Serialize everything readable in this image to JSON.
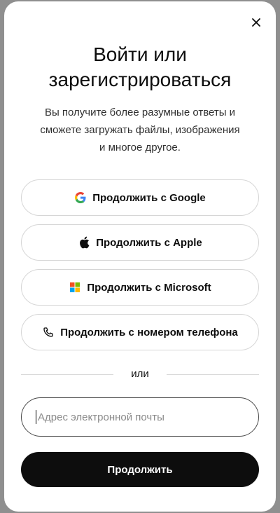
{
  "dialog": {
    "close_icon": "close-icon",
    "title_line1": "Войти или",
    "title_line2": "зарегистрироваться",
    "subtitle_line1": "Вы получите более разумные ответы и",
    "subtitle_line2": "сможете загружать файлы, изображения",
    "subtitle_line3": "и многое другое."
  },
  "providers": [
    {
      "label": "Продолжить с Google",
      "icon": "google-icon"
    },
    {
      "label": "Продолжить с Apple",
      "icon": "apple-icon"
    },
    {
      "label": "Продолжить с Microsoft",
      "icon": "microsoft-icon"
    },
    {
      "label": "Продолжить с номером телефона",
      "icon": "phone-icon"
    }
  ],
  "divider": {
    "label": "или"
  },
  "email": {
    "placeholder": "Адрес электронной почты",
    "value": ""
  },
  "submit": {
    "label": "Продолжить"
  },
  "colors": {
    "primary_button": "#0d0d0d",
    "border": "#d6d6d6",
    "overlay": "#8f8f8f"
  }
}
